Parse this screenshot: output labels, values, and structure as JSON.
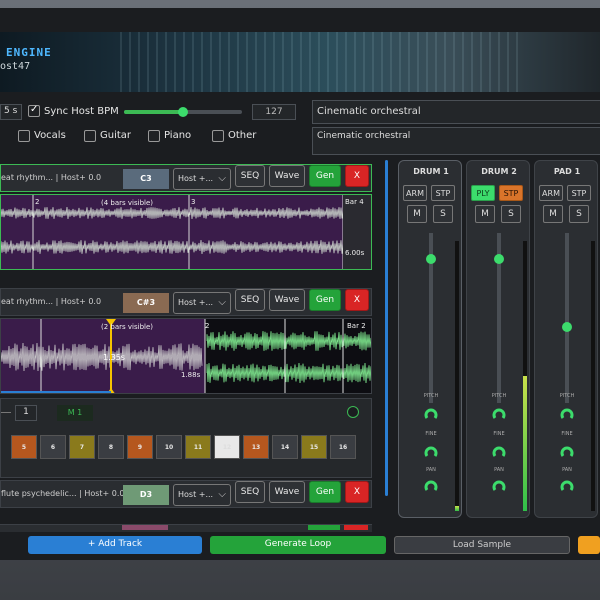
{
  "app": {
    "title": "ENGINE",
    "subtitle": "ost47"
  },
  "topbar": {
    "duration_value": "5 s",
    "sync_label": "Sync Host BPM",
    "sync_checked": true,
    "bpm_value": "127",
    "bpm_slider_fraction": 0.5,
    "prompt_main": "Cinematic orchestral",
    "prompt_secondary": "Cinematic orchestral",
    "categories": [
      "Vocals",
      "Guitar",
      "Piano",
      "Other"
    ]
  },
  "tracks": [
    {
      "name": "eat rhythm... | Host+ 0.0",
      "note": "C3",
      "note_color": "#5a6b7c",
      "select_label": "Host +...",
      "seq_label": "SEQ",
      "wave_label": "Wave",
      "gen_label": "Gen",
      "delete_label": "X",
      "bar_start": "2",
      "bar_mid": "3",
      "bars_visible": "(4 bars visible)",
      "bar_end": "Bar 4",
      "duration": "6.00s"
    },
    {
      "name": "eat rhythm... | Host+ 0.0",
      "note": "C#3",
      "note_color": "#8a6a52",
      "select_label": "Host +...",
      "seq_label": "SEQ",
      "wave_label": "Wave",
      "gen_label": "Gen",
      "delete_label": "X",
      "bars_visible": "(2 bars visible)",
      "bar_start": "2",
      "bar_end": "Bar 2",
      "playhead_time": "1.35s",
      "duration": "1.88s"
    },
    {
      "name": "flute psychedelic... | Host+ 0.0",
      "note": "D3",
      "note_color": "#6f9a76",
      "select_label": "Host +...",
      "seq_label": "SEQ",
      "wave_label": "Wave",
      "gen_label": "Gen",
      "delete_label": "X"
    }
  ],
  "sequencer": {
    "steps_value": "1",
    "mode_label": "M 1",
    "steps": [
      {
        "n": "5",
        "color": "#b5571e"
      },
      {
        "n": "6",
        "color": "#3a3d42"
      },
      {
        "n": "7",
        "color": "#8a7a1c"
      },
      {
        "n": "8",
        "color": "#3a3d42"
      },
      {
        "n": "9",
        "color": "#b5571e"
      },
      {
        "n": "10",
        "color": "#3a3d42"
      },
      {
        "n": "11",
        "color": "#8a7a1c"
      },
      {
        "n": "12",
        "color": "#e8e8e8"
      },
      {
        "n": "13",
        "color": "#b5571e"
      },
      {
        "n": "14",
        "color": "#3a3d42"
      },
      {
        "n": "15",
        "color": "#8a7a1c"
      },
      {
        "n": "16",
        "color": "#3a3d42"
      }
    ]
  },
  "mixer": {
    "strips": [
      {
        "name": "DRUM 1",
        "arm": "ARM",
        "stp": "STP",
        "mute": "M",
        "solo": "S",
        "playing": false,
        "fader_level": 0.85,
        "meter_level": 0.02,
        "pitch": "PITCH",
        "fine": "FINE",
        "pan": "PAN"
      },
      {
        "name": "DRUM 2",
        "arm": "PLY",
        "stp": "STP",
        "mute": "M",
        "solo": "S",
        "playing": true,
        "fader_level": 0.85,
        "meter_level": 0.5,
        "pitch": "PITCH",
        "fine": "FINE",
        "pan": "PAN"
      },
      {
        "name": "PAD 1",
        "arm": "ARM",
        "stp": "STP",
        "mute": "M",
        "solo": "S",
        "playing": false,
        "fader_level": 0.45,
        "meter_level": 0.0,
        "pitch": "PITCH",
        "fine": "FINE",
        "pan": "PAN"
      }
    ]
  },
  "footer": {
    "add_track": "+ Add Track",
    "generate_loop": "Generate Loop",
    "load_sample": "Load Sample"
  },
  "colors": {
    "accent_green": "#3cdc6c",
    "accent_blue": "#2a7fd4",
    "danger": "#d92525",
    "wave_bg": "#3a1c4a"
  }
}
